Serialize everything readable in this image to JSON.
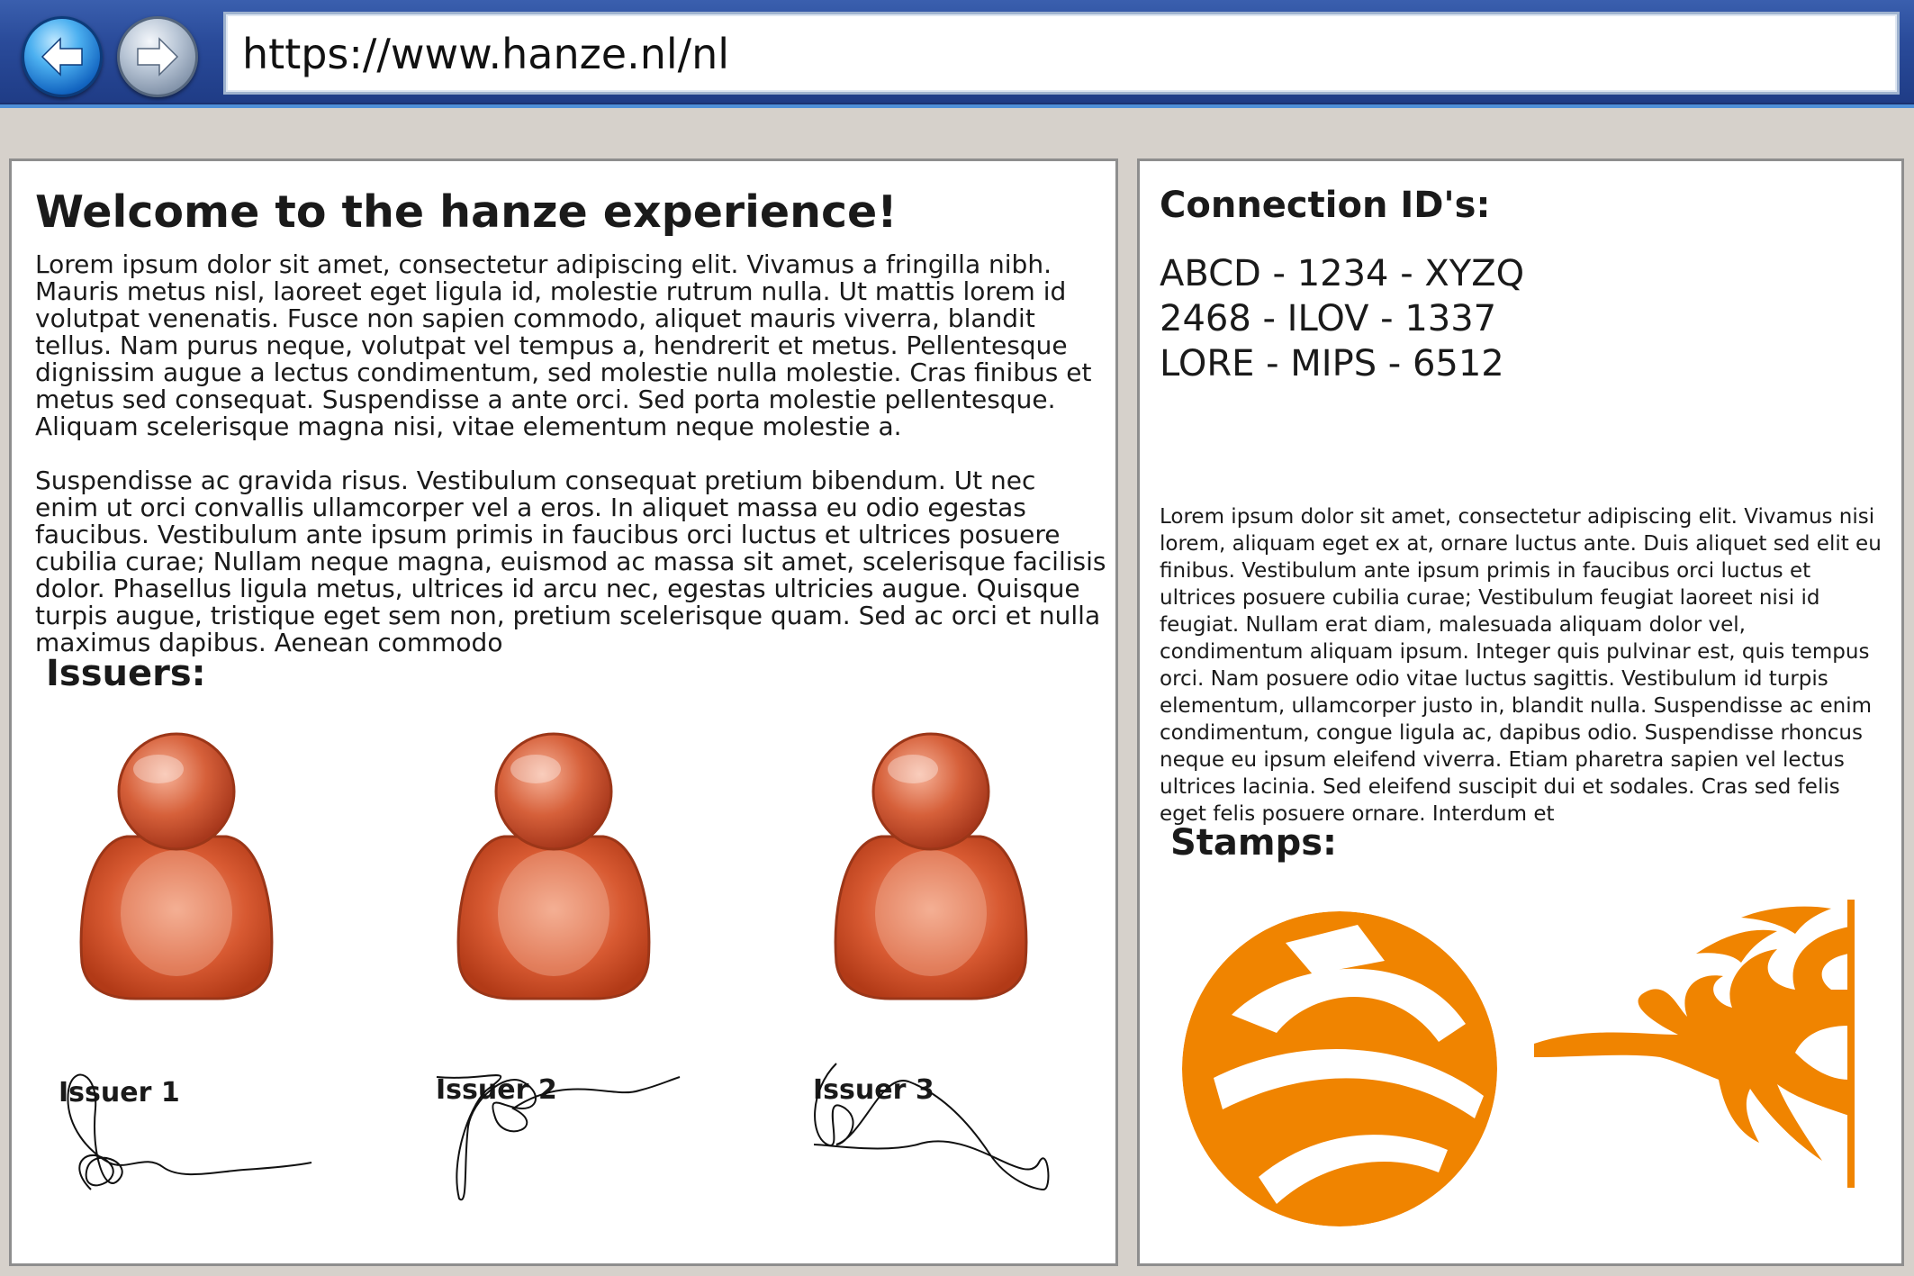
{
  "browser": {
    "back_icon": "back-arrow-icon",
    "forward_icon": "forward-arrow-icon",
    "url": "https://www.hanze.nl/nl"
  },
  "main": {
    "title": "Welcome to the hanze experience!",
    "paragraphs": [
      "Lorem ipsum dolor sit amet, consectetur adipiscing elit. Vivamus a fringilla nibh. Mauris metus nisl, laoreet eget ligula id, molestie rutrum nulla. Ut mattis lorem id volutpat venenatis. Fusce non sapien commodo, aliquet mauris viverra, blandit tellus. Nam purus neque, volutpat vel tempus a, hendrerit et metus. Pellentesque dignissim augue a lectus condimentum, sed molestie nulla molestie. Cras finibus et metus sed consequat. Suspendisse a ante orci. Sed porta molestie pellentesque. Aliquam scelerisque magna nisi, vitae elementum neque molestie a.",
      "Suspendisse ac gravida risus. Vestibulum consequat pretium bibendum. Ut nec enim ut orci convallis ullamcorper vel a eros. In aliquet massa eu odio egestas faucibus. Vestibulum ante ipsum primis in faucibus orci luctus et ultrices posuere cubilia curae; Nullam neque magna, euismod ac massa sit amet, scelerisque facilisis dolor. Phasellus ligula metus, ultrices id arcu nec, egestas ultricies augue. Quisque turpis augue, tristique eget sem non, pretium scelerisque quam. Sed ac orci et nulla maximus dapibus. Aenean commodo"
    ],
    "issuers_title": "Issuers:",
    "issuers": [
      {
        "label": "Issuer 1",
        "icon": "user-avatar-icon"
      },
      {
        "label": "Issuer 2",
        "icon": "user-avatar-icon"
      },
      {
        "label": "Issuer 3",
        "icon": "user-avatar-icon"
      }
    ]
  },
  "sidebar": {
    "connections_title": "Connection ID's:",
    "connection_ids": [
      "ABCD - 1234 - XYZQ",
      "2468 - ILOV - 1337",
      "LORE - MIPS - 6512"
    ],
    "paragraph": "Lorem ipsum dolor sit amet, consectetur adipiscing elit. Vivamus nisi lorem, aliquam eget ex at, ornare luctus ante. Duis aliquet sed elit eu finibus. Vestibulum ante ipsum primis in faucibus orci luctus et ultrices posuere cubilia curae; Vestibulum feugiat laoreet nisi id feugiat. Nullam erat diam, malesuada aliquam dolor vel, condimentum aliquam ipsum. Integer quis pulvinar est, quis tempus orci. Nam posuere odio vitae luctus sagittis. Vestibulum id turpis elementum, ullamcorper justo in, blandit nulla. Suspendisse ac enim condimentum, congue ligula ac, dapibus odio. Suspendisse rhoncus neque eu ipsum eleifend viverra. Etiam pharetra sapien vel lectus ultrices lacinia. Sed eleifend suscipit dui et sodales. Cras sed felis eget felis posuere ornare. Interdum et",
    "stamps_title": "Stamps:",
    "stamp_color": "#f08400"
  }
}
